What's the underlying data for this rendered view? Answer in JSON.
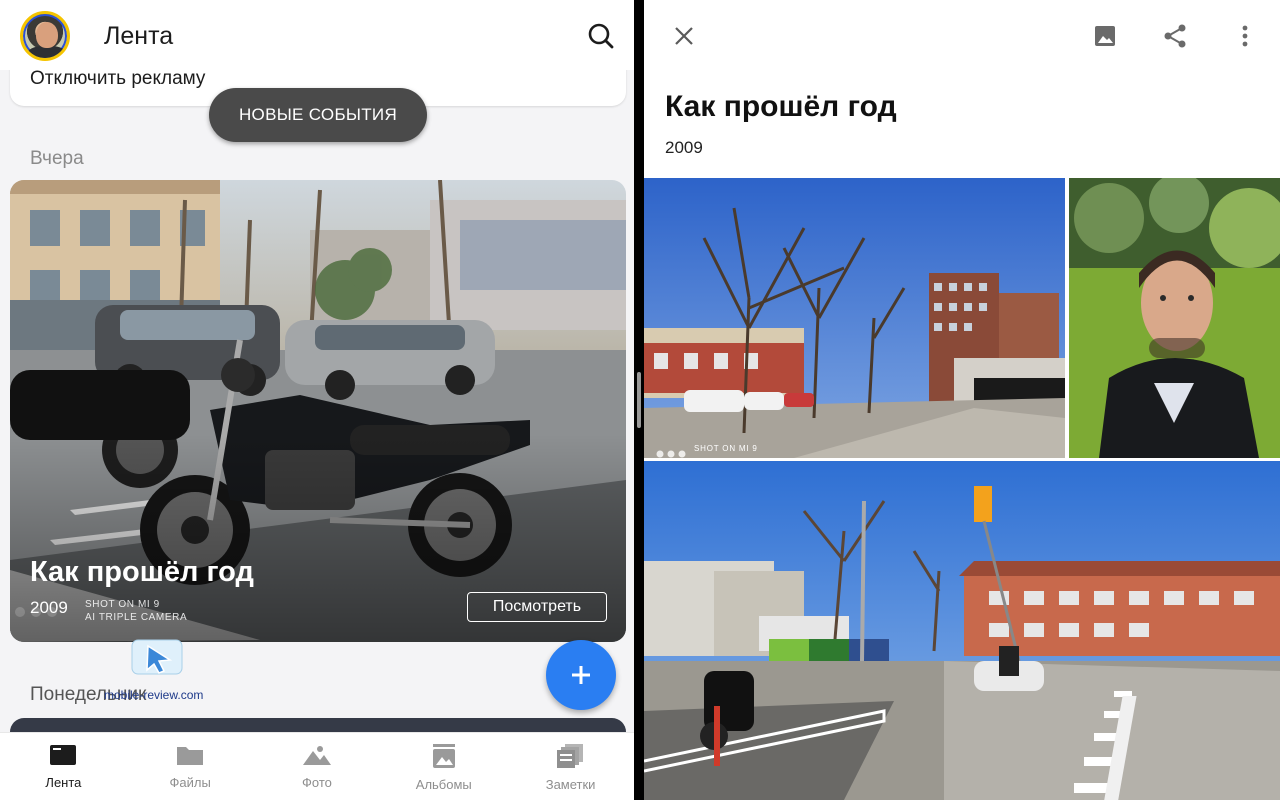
{
  "feed": {
    "title": "Лента",
    "ad_link": "Отключить рекламу",
    "new_events_button": "НОВЫЕ СОБЫТИЯ",
    "section_yesterday": "Вчера",
    "section_monday": "Понедельник",
    "story": {
      "title": "Как прошёл год",
      "year": "2009",
      "view_button": "Посмотреть",
      "camera_watermark_line1": "SHOT ON MI 9",
      "camera_watermark_line2": "AI TRIPLE CAMERA"
    },
    "fab_label": "+",
    "watermark_site": "mobile-review.com"
  },
  "bottom_nav": [
    {
      "label": "Лента",
      "icon": "feed-icon",
      "active": true
    },
    {
      "label": "Файлы",
      "icon": "folder-icon",
      "active": false
    },
    {
      "label": "Фото",
      "icon": "photo-icon",
      "active": false
    },
    {
      "label": "Альбомы",
      "icon": "albums-icon",
      "active": false
    },
    {
      "label": "Заметки",
      "icon": "notes-icon",
      "active": false
    }
  ],
  "detail": {
    "title": "Как прошёл год",
    "year": "2009",
    "photo_watermark": "SHOT ON MI 9",
    "toolbar_icons": [
      "close-icon",
      "image-icon",
      "share-icon",
      "more-icon"
    ]
  },
  "colors": {
    "accent": "#2a7ef2",
    "pill": "#4a4a4a"
  }
}
